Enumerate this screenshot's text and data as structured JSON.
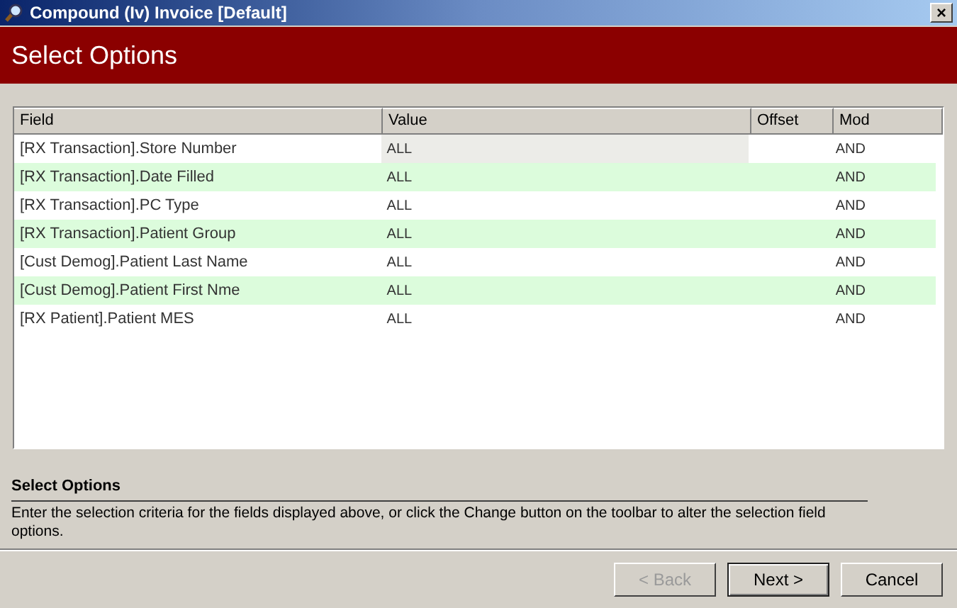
{
  "window": {
    "title": "Compound (Iv) Invoice [Default]",
    "close": "×"
  },
  "banner": {
    "title": "Select Options"
  },
  "table": {
    "columns": [
      "Field",
      "Value",
      "Offset",
      "Mod"
    ],
    "rows": [
      {
        "field": "[RX Transaction].Store Number",
        "value": "ALL",
        "mod": "AND",
        "selected": true
      },
      {
        "field": "[RX Transaction].Date Filled",
        "value": "ALL",
        "mod": "AND",
        "selected": false
      },
      {
        "field": "[RX Transaction].PC Type",
        "value": "ALL",
        "mod": "AND",
        "selected": false
      },
      {
        "field": "[RX Transaction].Patient Group",
        "value": "ALL",
        "mod": "AND",
        "selected": false
      },
      {
        "field": "[Cust Demog].Patient Last Name",
        "value": "ALL",
        "mod": "AND",
        "selected": false
      },
      {
        "field": "[Cust Demog].Patient First Nme",
        "value": "ALL",
        "mod": "AND",
        "selected": false
      },
      {
        "field": "[RX Patient].Patient MES",
        "value": "ALL",
        "mod": "AND",
        "selected": false
      }
    ]
  },
  "help": {
    "title": "Select Options",
    "text": "Enter the selection criteria for the fields displayed above, or click the Change button on the toolbar to alter the selection field options."
  },
  "buttons": [
    {
      "label": "< Back",
      "disabled": true,
      "default": false
    },
    {
      "label": "Next >",
      "disabled": false,
      "default": true
    },
    {
      "label": "Cancel",
      "disabled": false,
      "default": false
    }
  ]
}
